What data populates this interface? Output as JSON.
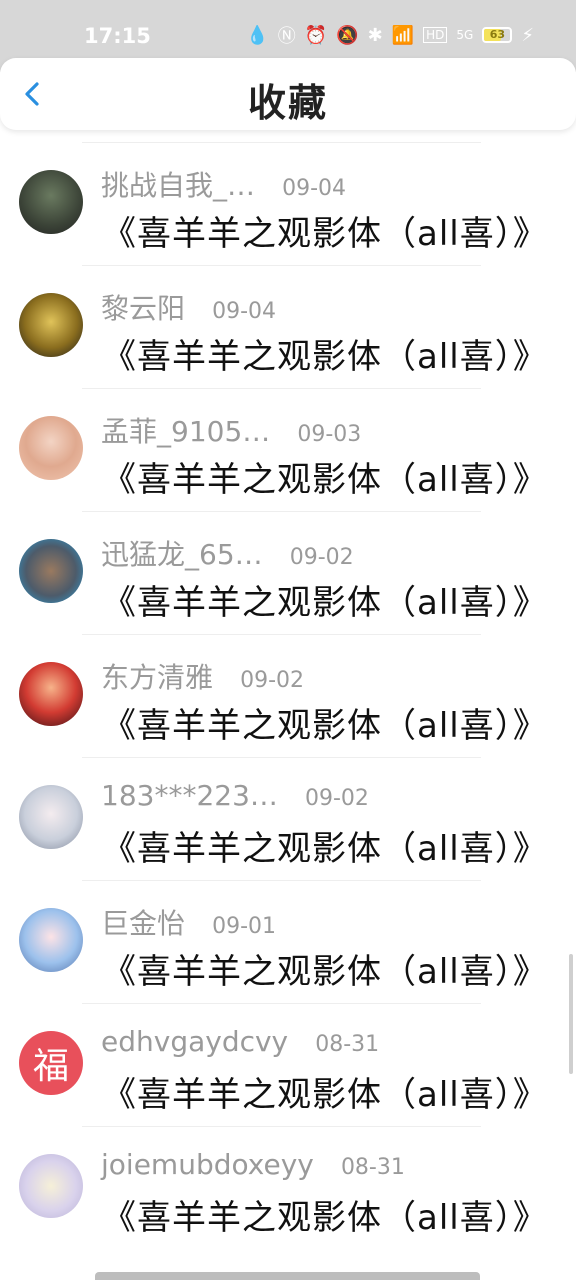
{
  "status_bar": {
    "time": "17:15",
    "battery_level": "63",
    "network": "5G"
  },
  "header": {
    "title": "收藏"
  },
  "items": [
    {
      "user": "挑战自我_…",
      "date": "09-04",
      "title": "《喜羊羊之观影体（all喜）》",
      "avatar_color": "#4d5a48"
    },
    {
      "user": "黎云阳",
      "date": "09-04",
      "title": "《喜羊羊之观影体（all喜）》",
      "avatar_color": "#b89b3a"
    },
    {
      "user": "孟菲_9105…",
      "date": "09-03",
      "title": "《喜羊羊之观影体（all喜）》",
      "avatar_color": "#e3a993"
    },
    {
      "user": "迅猛龙_65…",
      "date": "09-02",
      "title": "《喜羊羊之观影体（all喜）》",
      "avatar_color": "#6f8fa8"
    },
    {
      "user": "东方清雅",
      "date": "09-02",
      "title": "《喜羊羊之观影体（all喜）》",
      "avatar_color": "#c0392b"
    },
    {
      "user": "183***223…",
      "date": "09-02",
      "title": "《喜羊羊之观影体（all喜）》",
      "avatar_color": "#cfd6e0"
    },
    {
      "user": "巨金怡",
      "date": "09-01",
      "title": "《喜羊羊之观影体（all喜）》",
      "avatar_color": "#a7c6ea"
    },
    {
      "user": "edhvgaydcvy",
      "date": "08-31",
      "title": "《喜羊羊之观影体（all喜）》",
      "avatar_color": "#e8505b",
      "avatar_glyph": "福"
    },
    {
      "user": "joiemubdoxeyy",
      "date": "08-31",
      "title": "《喜羊羊之观影体（all喜）》",
      "avatar_color": "#d9d2ec"
    }
  ]
}
